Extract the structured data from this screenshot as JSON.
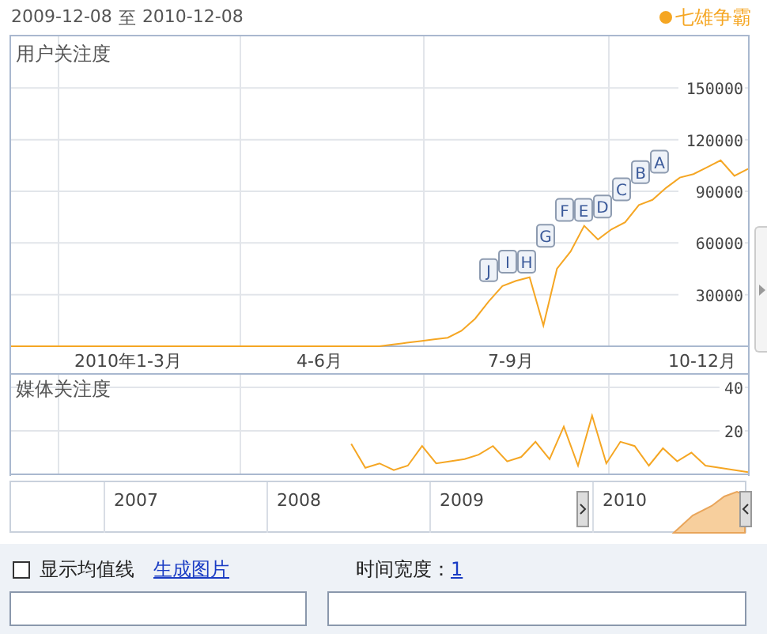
{
  "header": {
    "date_from": "2009-12-08",
    "separator": "至",
    "date_to": "2010-12-08",
    "legend": {
      "name": "七雄争霸",
      "color": "#f5a623"
    }
  },
  "user_chart": {
    "title": "用户关注度",
    "x_labels": [
      "2010年1-3月",
      "4-6月",
      "7-9月",
      "10-12月"
    ],
    "chart_data": {
      "type": "line",
      "ylim": [
        0,
        180000
      ],
      "grid": true,
      "yticks": [
        30000,
        60000,
        90000,
        120000,
        150000
      ],
      "series": [
        {
          "color": "#f5a623",
          "values": [
            0,
            0,
            0,
            0,
            0,
            0,
            0,
            0,
            0,
            0,
            0,
            0,
            0,
            0,
            0,
            0,
            0,
            0,
            0,
            0,
            0,
            0,
            0,
            0,
            0,
            0,
            0,
            0,
            1000,
            2000,
            3000,
            4000,
            5000,
            9000,
            16000,
            26000,
            35000,
            38000,
            40000,
            12000,
            45000,
            55000,
            70000,
            62000,
            68000,
            72000,
            82000,
            85000,
            92000,
            98000,
            100000,
            104000,
            108000,
            99000,
            103000
          ]
        }
      ],
      "annotations": [
        {
          "text": "J"
        },
        {
          "text": "I"
        },
        {
          "text": "H"
        },
        {
          "text": "G"
        },
        {
          "text": "F"
        },
        {
          "text": "E"
        },
        {
          "text": "D"
        },
        {
          "text": "C"
        },
        {
          "text": "B"
        },
        {
          "text": "A"
        }
      ]
    }
  },
  "media_chart": {
    "title": "媒体关注度",
    "chart_data": {
      "type": "line",
      "ylim": [
        0,
        40
      ],
      "yticks": [
        20,
        40
      ],
      "grid": true,
      "series": [
        {
          "color": "#f5a623",
          "values": [
            null,
            null,
            null,
            null,
            null,
            null,
            null,
            null,
            null,
            null,
            null,
            null,
            null,
            null,
            null,
            null,
            null,
            null,
            null,
            null,
            null,
            null,
            null,
            null,
            14,
            3,
            5,
            2,
            4,
            13,
            5,
            6,
            7,
            9,
            13,
            6,
            8,
            15,
            7,
            22,
            4,
            27,
            5,
            15,
            13,
            4,
            12,
            6,
            10,
            4,
            3,
            2,
            1
          ]
        }
      ]
    }
  },
  "navigator": {
    "years": [
      "2007",
      "2008",
      "2009",
      "2010"
    ]
  },
  "controls": {
    "show_average": {
      "label": "显示均值线",
      "checked": false
    },
    "export_link": "生成图片",
    "time_width_label": "时间宽度：",
    "time_width_link": "1"
  }
}
